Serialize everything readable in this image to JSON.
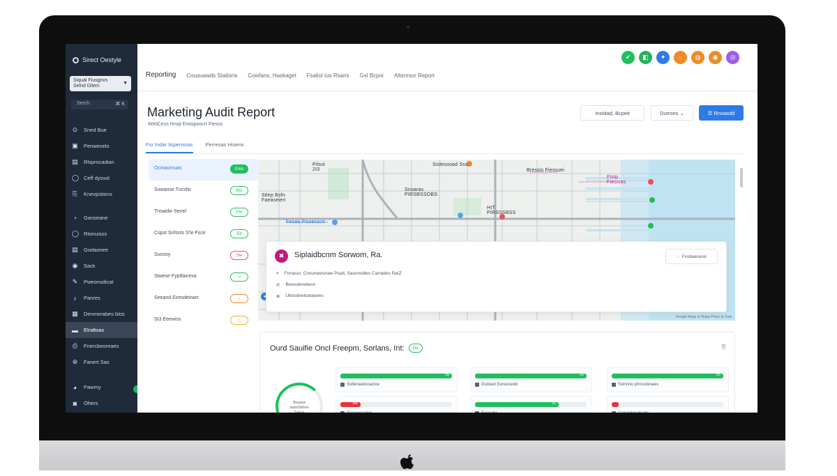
{
  "sidebar": {
    "brand": "Sirect Oestyle",
    "workspace": "Siqual Fiusgnvs\nSelnd Dilem",
    "search_placeholder": "Serch",
    "search_key": "⌘ K",
    "items": [
      {
        "icon": "⊙",
        "label": "Sned Bue"
      },
      {
        "icon": "▣",
        "label": "Penweselo"
      },
      {
        "icon": "▤",
        "label": "Rlsprocadian"
      },
      {
        "icon": "◯",
        "label": "Ceff dysvol"
      },
      {
        "icon": "⎘",
        "label": "Knevpstions"
      },
      {
        "icon": "◔",
        "label": "Ganseane"
      },
      {
        "icon": "◯",
        "label": "Rtonuisos"
      },
      {
        "icon": "▤",
        "label": "Godaonee"
      },
      {
        "icon": "◉",
        "label": "Sack"
      },
      {
        "icon": "✎",
        "label": "Pweonsdicat"
      },
      {
        "icon": "♪",
        "label": "Panres"
      },
      {
        "icon": "▦",
        "label": "Denmerabes blos"
      },
      {
        "icon": "▬",
        "label": "Elraltoas"
      },
      {
        "icon": "⎙",
        "label": "Fnercbeoreaes"
      },
      {
        "icon": "⊚",
        "label": "Fanert Sas"
      },
      {
        "icon": "◕",
        "label": "Pawmy"
      },
      {
        "icon": "◙",
        "label": "Ohers"
      }
    ]
  },
  "topbar": {
    "tabs": [
      "Reporting",
      "Cousuawds Stations",
      "Cowfans, Haskaget",
      "Fsaliol tus Rsans",
      "Gsl Bcpoi",
      "Altonrsor Report"
    ],
    "circle_icons": [
      {
        "glyph": "✔",
        "color": "#1fbf5b"
      },
      {
        "glyph": "◧",
        "color": "#22b35e"
      },
      {
        "glyph": "✦",
        "color": "#2f7be6"
      },
      {
        "glyph": "◌",
        "color": "#f08a24"
      },
      {
        "glyph": "◍",
        "color": "#f08a24"
      },
      {
        "glyph": "◉",
        "color": "#e88d2b"
      },
      {
        "glyph": "◎",
        "color": "#9d5de6"
      }
    ]
  },
  "header": {
    "title": "Marketing Audit Report",
    "subtitle": "WetiCess Hnsjt Enospoocrt Fiesss",
    "btn_secondary": "Inoidad, Bcpeit",
    "btn_outline": "Dutrons ⌄",
    "btn_primary": "☰ Rnoaxdd"
  },
  "subtabs": [
    "Fsr Indar Iispenssas",
    "Perresas Hisens"
  ],
  "filters": [
    {
      "label": "Ocinaumuas",
      "pill": "Enio",
      "pill_color": "#1fbf5b",
      "filled": true
    },
    {
      "label": "Suwanse Tncsfw",
      "pill": "Blo",
      "pill_color": "#1fbf5b",
      "filled": false
    },
    {
      "label": "Tnsaidw Senel",
      "pill": "Pw",
      "pill_color": "#1fbf5b",
      "filled": false
    },
    {
      "label": "Cspst Snfsnts S'le Fsce",
      "pill": "Eb",
      "pill_color": "#1fbf5b",
      "filled": false
    },
    {
      "label": "Suosoy",
      "pill": "Sw",
      "pill_color": "#e8505b",
      "filled": false
    },
    {
      "label": "Stwese Fyptfaicesa",
      "pill": "—",
      "pill_color": "#1fbf5b",
      "filled": false
    },
    {
      "label": "Seeand Eiresdeinart",
      "pill": "♁",
      "pill_color": "#f08a24",
      "filled": false
    },
    {
      "label": "SI3 Eeewiss",
      "pill": "△",
      "pill_color": "#f0b324",
      "filled": false
    }
  ],
  "map": {
    "labels": [
      {
        "text": "Pilsol\n2I3"
      },
      {
        "text": "Sislesooad Ssa"
      },
      {
        "text": "Bressis Fiessuei"
      },
      {
        "text": "Snoaras\nPIRSBSSOBS"
      },
      {
        "text": "Stlep Bsfn\nFaeaseieri"
      },
      {
        "text": "Fesas Pisoecsce"
      },
      {
        "text": "HIT\nPIRSSSBSS"
      },
      {
        "text": "Ftslp\nFiessias"
      }
    ],
    "credit": "Geogle Mags  ⊕ Mapp Ptons  ⊕ Guer"
  },
  "business": {
    "logo": "✖",
    "name": "Siplaidbcnm Sorwom, Ra.",
    "rows": [
      {
        "icon": "⌖",
        "text": "Fnnasur, Cnsunwesrtaw Poait, Sasnnsdles Carrades RaIZ"
      },
      {
        "icon": "✆",
        "text": "Bwosdenetesn"
      },
      {
        "icon": "⊕",
        "text": "Ubosdnetoatasees"
      }
    ],
    "button": "Fosbaeresis"
  },
  "score": {
    "title": "Ourd Sauifie Oncl Freepm, Sorlans, Int:",
    "badge": "Oe",
    "gauge_text": "Bnsaod\nsusorSsfoos\nSaiors",
    "metrics": [
      {
        "label": "Sollwraedsnacloe",
        "value": 1.0,
        "value_text": "0b",
        "color": "#1fbf5b"
      },
      {
        "label": "Dsdoed Eensosedo",
        "value": 1.0,
        "value_text": "e5",
        "color": "#1fbf5b"
      },
      {
        "label": "Sslnnne pmcsstesees",
        "value": 1.0,
        "value_text": "Dc",
        "color": "#1fbf5b"
      },
      {
        "label": "Snevcrcasbrn",
        "value": 0.18,
        "value_text": "5rb",
        "color": "#e8323c"
      },
      {
        "label": "Enocabe",
        "value": 0.75,
        "value_text": "51",
        "color": "#1fbf5b"
      },
      {
        "label": "Caneivtesaleads",
        "value": 0.06,
        "value_text": "",
        "color": "#e8323c"
      }
    ]
  }
}
